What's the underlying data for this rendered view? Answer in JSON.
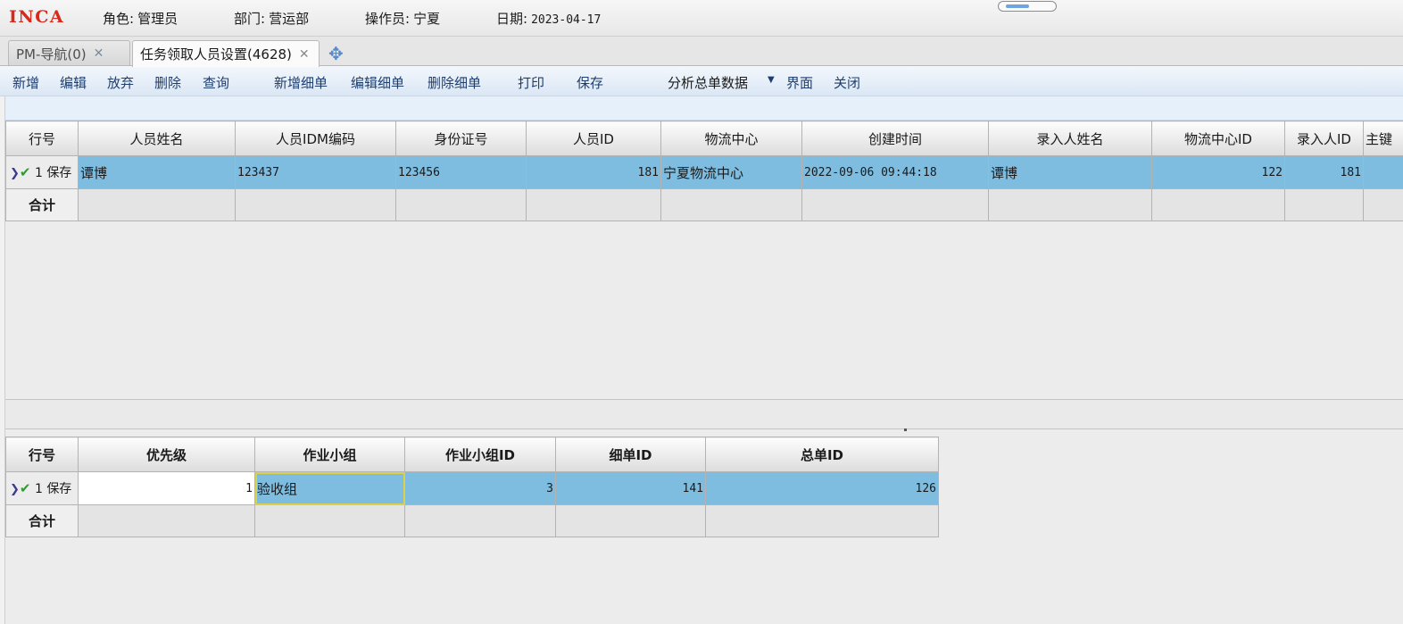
{
  "header": {
    "logo": "INCA",
    "role_label": "角色:",
    "role_value": "管理员",
    "dept_label": "部门:",
    "dept_value": "营运部",
    "operator_label": "操作员:",
    "operator_value": "宁夏",
    "date_label": "日期:",
    "date_value": "2023-04-17"
  },
  "tabs": [
    {
      "label": "PM-导航(0)"
    },
    {
      "label": "任务领取人员设置(4628)"
    }
  ],
  "toolbar": {
    "new": "新增",
    "edit": "编辑",
    "discard": "放弃",
    "delete": "删除",
    "query": "查询",
    "new_detail": "新增细单",
    "edit_detail": "编辑细单",
    "delete_detail": "删除细单",
    "print": "打印",
    "save": "保存",
    "analyze": "分析总单数据",
    "interface": "界面",
    "close": "关闭"
  },
  "master_grid": {
    "headers": [
      "行号",
      "人员姓名",
      "人员IDM编码",
      "身份证号",
      "人员ID",
      "物流中心",
      "创建时间",
      "录入人姓名",
      "物流中心ID",
      "录入人ID",
      "主键"
    ],
    "row": {
      "rownum": "1",
      "status": "保存",
      "name": "谭博",
      "idm": "123437",
      "idcard": "123456",
      "person_id": "181",
      "center": "宁夏物流中心",
      "created": "2022-09-06 09:44:18",
      "entry_name": "谭博",
      "center_id": "122",
      "entry_id": "181"
    },
    "total_label": "合计"
  },
  "detail_grid": {
    "headers": [
      "行号",
      "优先级",
      "作业小组",
      "作业小组ID",
      "细单ID",
      "总单ID"
    ],
    "row": {
      "rownum": "1",
      "status": "保存",
      "priority": "1",
      "group": "验收组",
      "group_id": "3",
      "detail_id": "141",
      "master_id": "126"
    },
    "total_label": "合计"
  }
}
